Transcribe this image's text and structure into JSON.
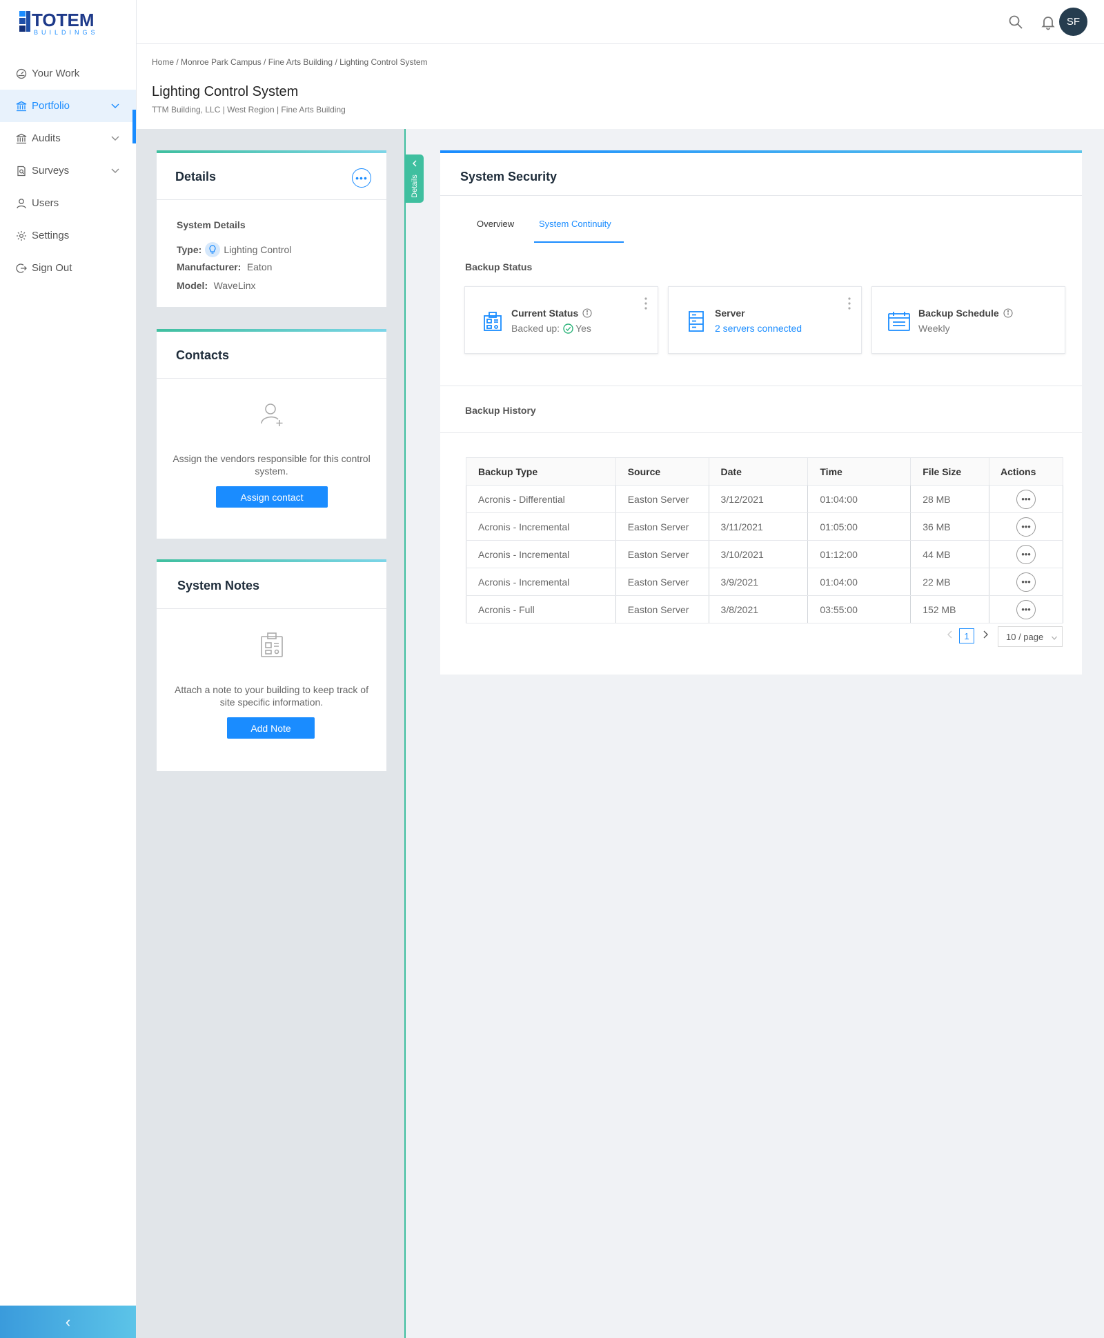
{
  "brand": {
    "name": "TOTEM",
    "tagline": "BUILDINGS"
  },
  "sidebar": {
    "items": [
      {
        "label": "Your Work",
        "icon": "dashboard-icon"
      },
      {
        "label": "Portfolio",
        "icon": "bank-icon",
        "active": true
      },
      {
        "label": "Audits",
        "icon": "bank-icon"
      },
      {
        "label": "Surveys",
        "icon": "file-search-icon"
      },
      {
        "label": "Users",
        "icon": "user-icon"
      },
      {
        "label": "Settings",
        "icon": "gear-icon"
      },
      {
        "label": "Sign Out",
        "icon": "logout-icon"
      }
    ],
    "collapse_glyph": "‹"
  },
  "topbar": {
    "avatar_initials": "SF"
  },
  "header": {
    "breadcrumb": "Home / Monroe Park Campus / Fine Arts Building / Lighting Control System",
    "title": "Lighting Control System",
    "subtitle": "TTM Building, LLC | West Region | Fine Arts Building"
  },
  "details_card": {
    "title": "Details",
    "section": "System Details",
    "type_label": "Type:",
    "type_value": "Lighting Control",
    "manufacturer_label": "Manufacturer:",
    "manufacturer_value": "Eaton",
    "model_label": "Model:",
    "model_value": "WaveLinx"
  },
  "contacts_card": {
    "title": "Contacts",
    "empty_text": "Assign the vendors responsible for this control system.",
    "button": "Assign contact"
  },
  "notes_card": {
    "title": "System Notes",
    "empty_text": "Attach a note to your building to keep track of site specific information.",
    "button": "Add Note"
  },
  "details_tab": {
    "label": "Details"
  },
  "panel": {
    "title": "System Security",
    "tabs": [
      "Overview",
      "System Continuity"
    ],
    "active_tab": "System Continuity",
    "backup_status_label": "Backup Status",
    "status_cards": [
      {
        "title": "Current Status",
        "value_prefix": "Backed up:",
        "value": "Yes"
      },
      {
        "title": "Server",
        "value": "2 servers connected"
      },
      {
        "title": "Backup Schedule",
        "value": "Weekly"
      }
    ],
    "backup_history_label": "Backup History",
    "table": {
      "columns": [
        "Backup Type",
        "Source",
        "Date",
        "Time",
        "File Size",
        "Actions"
      ],
      "rows": [
        [
          "Acronis - Differential",
          "Easton Server",
          "3/12/2021",
          "01:04:00",
          "28 MB"
        ],
        [
          "Acronis - Incremental",
          "Easton Server",
          "3/11/2021",
          "01:05:00",
          "36 MB"
        ],
        [
          "Acronis - Incremental",
          "Easton Server",
          "3/10/2021",
          "01:12:00",
          "44 MB"
        ],
        [
          "Acronis - Incremental",
          "Easton Server",
          "3/9/2021",
          "01:04:00",
          "22 MB"
        ],
        [
          "Acronis - Full",
          "Easton Server",
          "3/8/2021",
          "03:55:00",
          "152 MB"
        ]
      ]
    },
    "pagination": {
      "current_page": "1",
      "page_size": "10 / page"
    }
  },
  "colors": {
    "accent": "#1a8cff",
    "teal": "#3fbf9f",
    "avatar_bg": "#263d4f",
    "success": "#2db37a"
  }
}
